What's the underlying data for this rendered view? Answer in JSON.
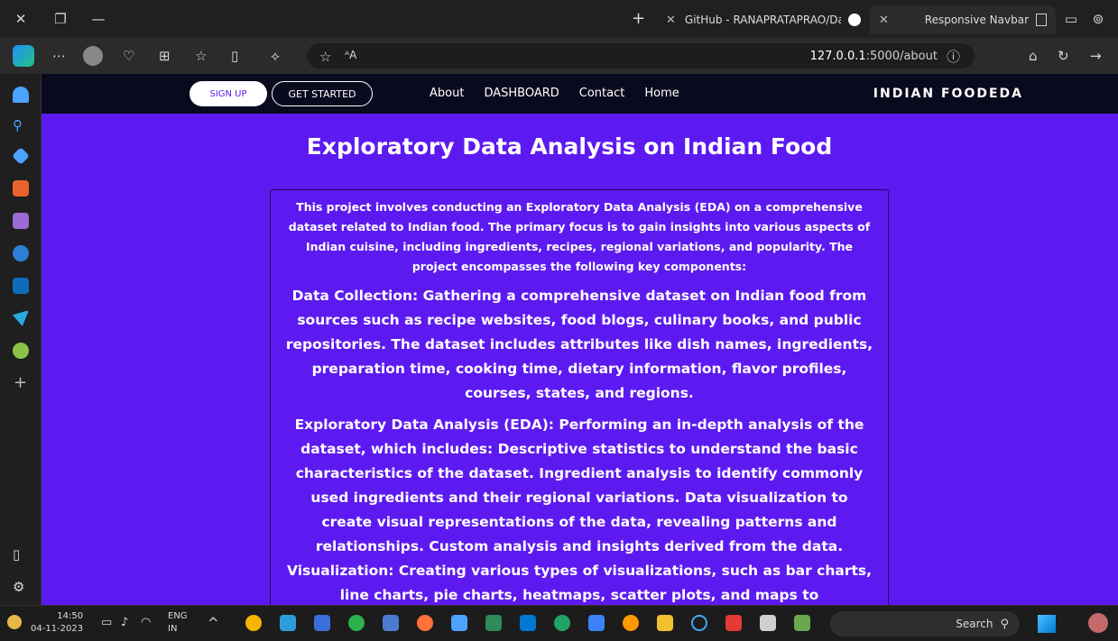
{
  "browser": {
    "tabs": [
      {
        "label": "Responsive Navbar"
      },
      {
        "label": "GitHub - RANAPRATAPRAO/Dat"
      }
    ],
    "new_tab": "+",
    "url_host": "127.0.0.1",
    "url_rest": ":5000/about"
  },
  "site": {
    "brand": "INDIAN FOODEDA",
    "nav": [
      "Home",
      "Contact",
      "DASHBOARD",
      "About"
    ],
    "get_started": "GET STARTED",
    "sign_up": "SIGN UP"
  },
  "page": {
    "title": "Exploratory Data Analysis on Indian Food",
    "intro": "This project involves conducting an Exploratory Data Analysis (EDA) on a comprehensive dataset related to Indian food. The primary focus is to gain insights into various aspects of Indian cuisine, including ingredients, recipes, regional variations, and popularity. The project encompasses the following key components:",
    "data_collection": "Data Collection: Gathering a comprehensive dataset on Indian food from sources such as recipe websites, food blogs, culinary books, and public repositories. The dataset includes attributes like dish names, ingredients, preparation time, cooking time, dietary information, flavor profiles, courses, states, and regions.",
    "eda": "Exploratory Data Analysis (EDA): Performing an in-depth analysis of the dataset, which includes: Descriptive statistics to understand the basic characteristics of the dataset. Ingredient analysis to identify commonly used ingredients and their regional variations. Data visualization to create visual representations of the data, revealing patterns and relationships. Custom analysis and insights derived from the data. Visualization: Creating various types of visualizations, such as bar charts, line charts, pie charts, heatmaps, scatter plots, and maps to"
  },
  "taskbar": {
    "search": "Search",
    "lang_1": "ENG",
    "lang_2": "IN",
    "time": "14:50",
    "date": "04-11-2023"
  },
  "colors": {
    "page_bg": "#5d1af0",
    "nav_bg": "#0a0a1e"
  }
}
